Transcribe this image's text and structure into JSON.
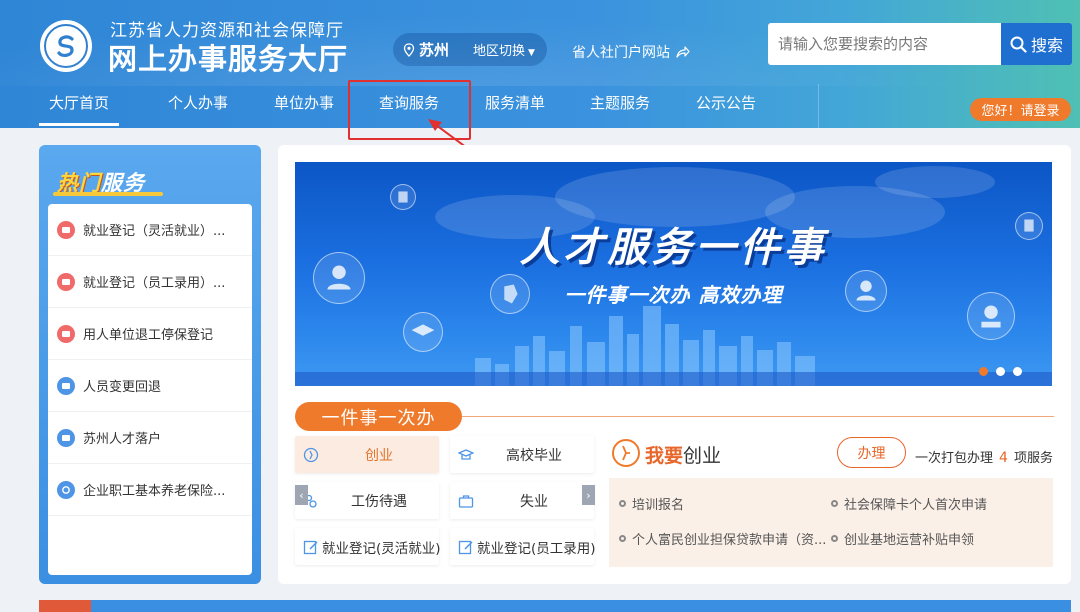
{
  "header": {
    "org_name": "江苏省人力资源和社会保障厅",
    "site_name": "网上办事服务大厅",
    "region": {
      "city": "苏州",
      "switch_label": "地区切换"
    },
    "portal_link": "省人社门户网站",
    "search": {
      "placeholder": "请输入您要搜索的内容",
      "button_label": "搜索"
    },
    "login_label": "您好！请登录"
  },
  "nav": {
    "items": [
      {
        "label": "大厅首页",
        "active": true
      },
      {
        "label": "个人办事"
      },
      {
        "label": "单位办事"
      },
      {
        "label": "查询服务"
      },
      {
        "label": "服务清单"
      },
      {
        "label": "主题服务"
      },
      {
        "label": "公示公告"
      }
    ]
  },
  "hot_services": {
    "title_accent": "热门",
    "title_rest": "服务",
    "items": [
      {
        "label": "就业登记（灵活就业）...",
        "icon": "id-card-icon",
        "color": "#f06a6a"
      },
      {
        "label": "就业登记（员工录用）...",
        "icon": "id-card-icon",
        "color": "#f06a6a"
      },
      {
        "label": "用人单位退工停保登记",
        "icon": "id-card-icon",
        "color": "#f06a6a"
      },
      {
        "label": "人员变更回退",
        "icon": "id-card-icon",
        "color": "#4f95e6"
      },
      {
        "label": "苏州人才落户",
        "icon": "id-card-icon",
        "color": "#4f95e6"
      },
      {
        "label": "企业职工基本养老保险...",
        "icon": "pension-icon",
        "color": "#4f95e6"
      }
    ]
  },
  "banner": {
    "title": "人才服务一件事",
    "subtitle": "一件事一次办  高效办理"
  },
  "one_thing": {
    "tab_label": "一件事一次办",
    "buttons": [
      {
        "label": "创业",
        "icon": "startup-icon",
        "active": true
      },
      {
        "label": "高校毕业",
        "icon": "graduate-icon"
      },
      {
        "label": "工伤待遇",
        "icon": "injury-icon"
      },
      {
        "label": "失业",
        "icon": "briefcase-icon"
      },
      {
        "label": "就业登记(灵活就业)",
        "icon": "edit-icon"
      },
      {
        "label": "就业登记(员工录用)",
        "icon": "edit-icon"
      }
    ],
    "detail": {
      "title_prefix": "我要",
      "title_topic": "创业",
      "handle_label": "办理",
      "bundle_prefix": "一次打包办理",
      "bundle_count": "4",
      "bundle_suffix": "项服务",
      "items": [
        "培训报名",
        "社会保障卡个人首次申请",
        "个人富民创业担保贷款申请（资...",
        "创业基地运营补贴申领"
      ]
    }
  },
  "colors": {
    "header_blue": "#2f86d6",
    "accent_orange": "#f07a2c",
    "annotation_red": "#e03030"
  }
}
